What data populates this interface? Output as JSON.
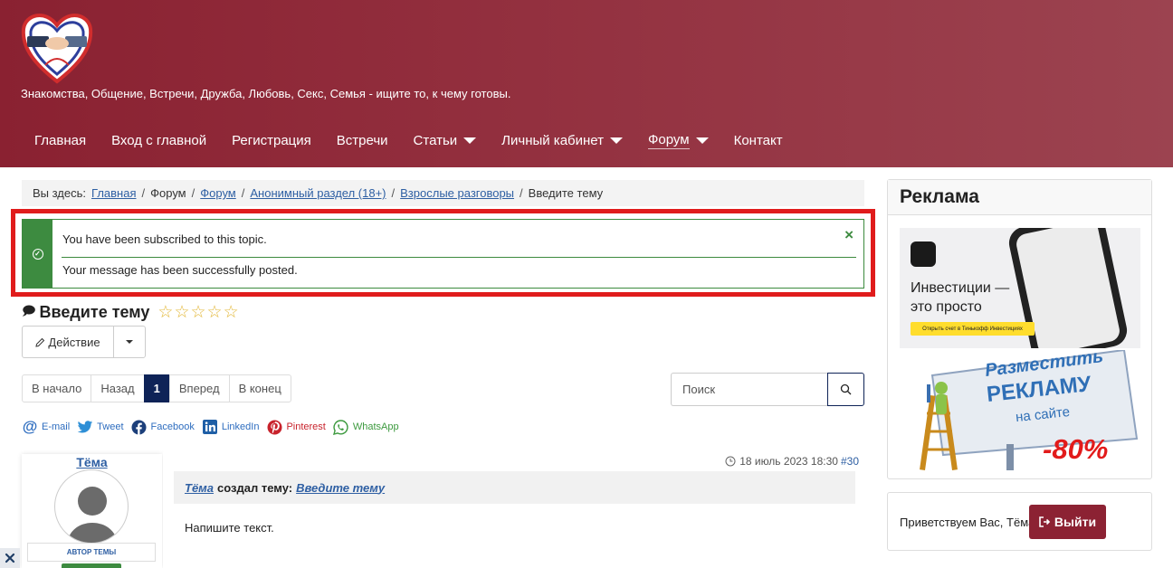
{
  "header": {
    "tagline": "Знакомства, Общение, Встречи, Дружба, Любовь, Секс, Семья - ищите то, к чему готовы.",
    "nav": [
      {
        "label": "Главная",
        "dropdown": false
      },
      {
        "label": "Вход с главной",
        "dropdown": false
      },
      {
        "label": "Регистрация",
        "dropdown": false
      },
      {
        "label": "Встречи",
        "dropdown": false
      },
      {
        "label": "Статьи",
        "dropdown": true
      },
      {
        "label": "Личный кабинет",
        "dropdown": true
      },
      {
        "label": "Форум",
        "dropdown": true,
        "active": true
      },
      {
        "label": "Контакт",
        "dropdown": false
      }
    ]
  },
  "breadcrumb": {
    "lead": "Вы здесь:",
    "items": [
      "Главная",
      "Форум",
      "Форум",
      "Анонимный раздел (18+)",
      "Взрослые разговоры",
      "Введите тему"
    ]
  },
  "alert": {
    "message1": "You have been subscribed to this topic.",
    "message2": "Your message has been successfully posted.",
    "close": "×"
  },
  "topic": {
    "title": "Введите тему",
    "stars": [
      "☆",
      "☆",
      "☆",
      "☆",
      "☆"
    ]
  },
  "action": {
    "label": "Действие"
  },
  "pagination": [
    "В начало",
    "Назад",
    "1",
    "Вперед",
    "В конец"
  ],
  "search": {
    "placeholder": "Поиск"
  },
  "share": [
    {
      "label": "E-mail",
      "icon": "@"
    },
    {
      "label": "Tweet",
      "icon": "twitter"
    },
    {
      "label": "Facebook",
      "icon": "f"
    },
    {
      "label": "LinkedIn",
      "icon": "in"
    },
    {
      "label": "Pinterest",
      "icon": "P"
    },
    {
      "label": "WhatsApp",
      "icon": "whatsapp"
    }
  ],
  "post": {
    "username": "Тёма",
    "badge": "АВТОР ТЕМЫ",
    "date": "18 июль 2023 18:30",
    "number": "#30",
    "author": "Тёма",
    "action": "создал тему:",
    "topic_link": "Введите тему",
    "text": "Напишите текст."
  },
  "sidebar": {
    "ad_title": "Реклама",
    "ad1_text": "Инвестиции — это просто",
    "ad1_button": "Открыть счет в Тинькофф Инвестициях",
    "ad2_line1": "Разместить",
    "ad2_line2": "РЕКЛАМУ",
    "ad2_line3": "на сайте",
    "ad2_discount": "-80%",
    "welcome": "Приветствуем Вас, Тёма",
    "logout": "Выйти"
  },
  "colors": {
    "header": "#8a2131",
    "accent_navy": "#0e2357",
    "success": "#3d8b40",
    "highlight": "#e01c1c",
    "logout": "#8c2233"
  }
}
